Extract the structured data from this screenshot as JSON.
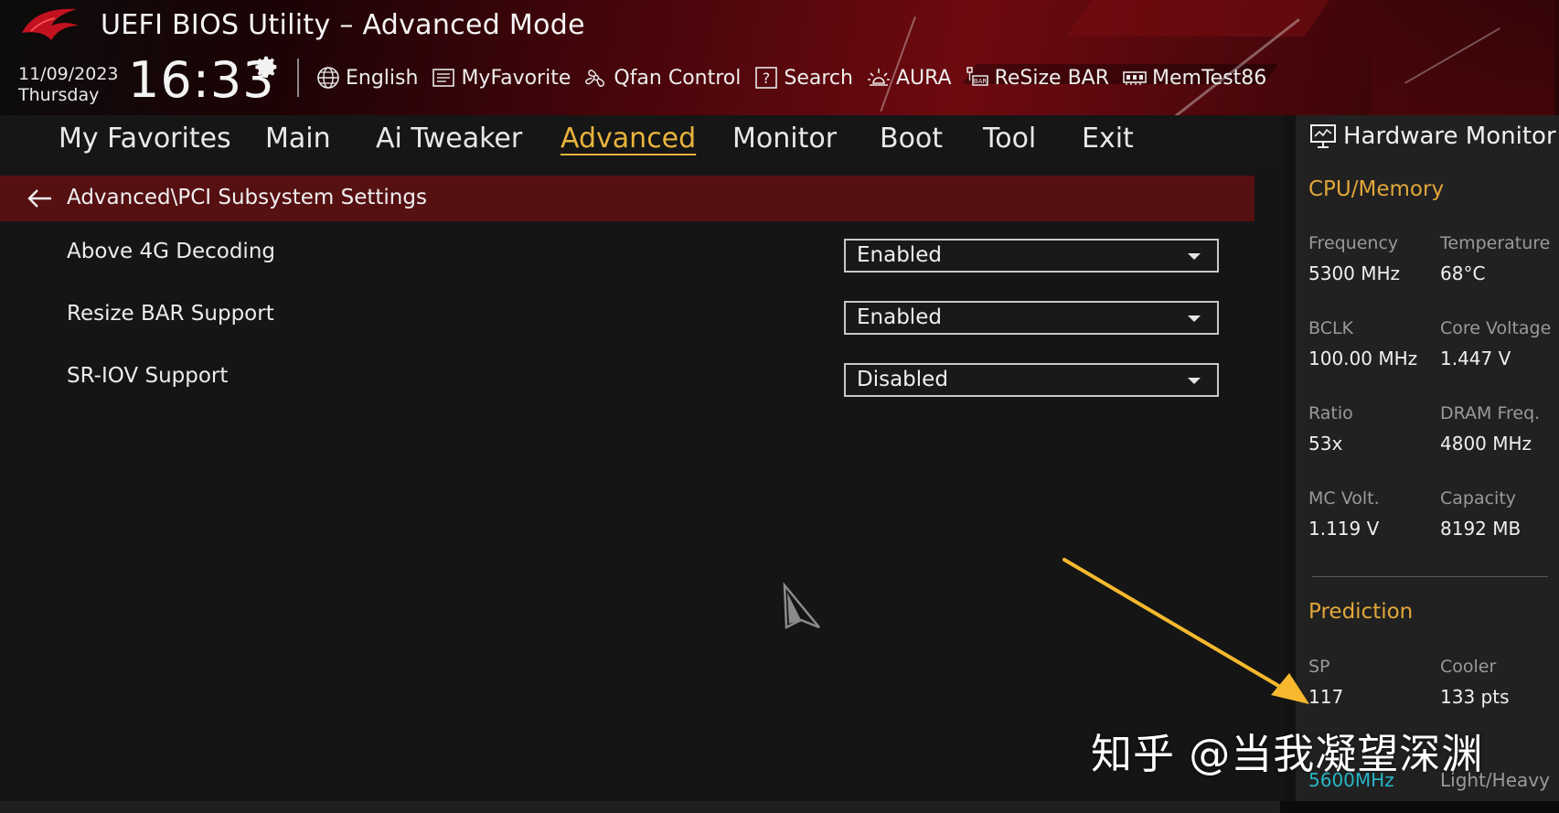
{
  "header": {
    "title": "UEFI BIOS Utility – Advanced Mode",
    "date": "11/09/2023",
    "day": "Thursday",
    "time": "16:33",
    "toolbar": [
      {
        "label": "English",
        "icon": "globe-icon"
      },
      {
        "label": "MyFavorite",
        "icon": "favorite-list-icon"
      },
      {
        "label": "Qfan Control",
        "icon": "fan-icon"
      },
      {
        "label": "Search",
        "icon": "help-search-icon"
      },
      {
        "label": "AURA",
        "icon": "aura-light-icon"
      },
      {
        "label": "ReSize BAR",
        "icon": "resize-bar-icon"
      },
      {
        "label": "MemTest86",
        "icon": "memory-icon"
      }
    ]
  },
  "nav": {
    "tabs": [
      {
        "label": "My Favorites"
      },
      {
        "label": "Main"
      },
      {
        "label": "Ai Tweaker"
      },
      {
        "label": "Advanced",
        "active": true
      },
      {
        "label": "Monitor"
      },
      {
        "label": "Boot"
      },
      {
        "label": "Tool"
      },
      {
        "label": "Exit"
      }
    ]
  },
  "content": {
    "breadcrumb": "Advanced\\PCI Subsystem Settings",
    "settings": [
      {
        "label": "Above 4G Decoding",
        "value": "Enabled"
      },
      {
        "label": "Resize BAR Support",
        "value": "Enabled"
      },
      {
        "label": "SR-IOV Support",
        "value": "Disabled"
      }
    ]
  },
  "hardware_monitor": {
    "title": "Hardware Monitor",
    "cpu_memory": {
      "heading": "CPU/Memory",
      "items": [
        {
          "label": "Frequency",
          "value": "5300 MHz"
        },
        {
          "label": "Temperature",
          "value": "68°C"
        },
        {
          "label": "BCLK",
          "value": "100.00 MHz"
        },
        {
          "label": "Core Voltage",
          "value": "1.447 V"
        },
        {
          "label": "Ratio",
          "value": "53x"
        },
        {
          "label": "DRAM Freq.",
          "value": "4800 MHz"
        },
        {
          "label": "MC Volt.",
          "value": "1.119 V"
        },
        {
          "label": "Capacity",
          "value": "8192 MB"
        }
      ]
    },
    "prediction": {
      "heading": "Prediction",
      "items": [
        {
          "label": "SP",
          "value": "117"
        },
        {
          "label": "Cooler",
          "value": "133 pts"
        }
      ],
      "extra": [
        {
          "value": "5600MHz"
        },
        {
          "value": "Light/Heavy"
        }
      ]
    }
  },
  "annotation": {
    "watermark": "知乎 @当我凝望深渊",
    "arrow_color": "#f5b82e"
  },
  "colors": {
    "accent": "#e9b43c",
    "breadcrumb_bg": "#561012",
    "teal_value": "#27b6c4"
  }
}
